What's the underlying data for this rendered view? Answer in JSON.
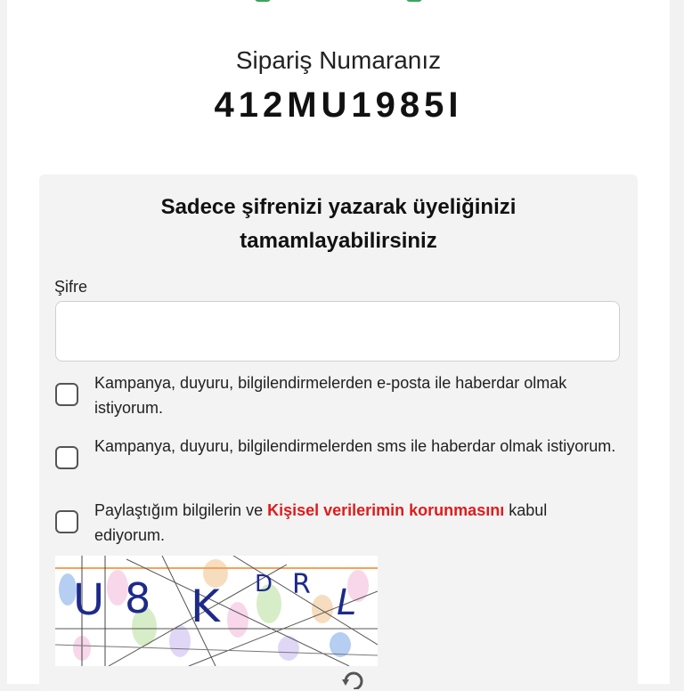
{
  "order": {
    "label": "Sipariş Numaranız",
    "number": "412MU1985I"
  },
  "registration": {
    "title": "Sadece şifrenizi yazarak üyeliğinizi tamamlayabilirsiniz",
    "password_label": "Şifre",
    "password_value": "",
    "checkboxes": [
      {
        "label": "Kampanya, duyuru, bilgilendirmelerden e-posta ile haberdar olmak istiyorum.",
        "checked": false
      },
      {
        "label": "Kampanya, duyuru, bilgilendirmelerden sms ile haberdar olmak istiyorum.",
        "checked": false
      },
      {
        "label_before": "Paylaştığım bilgilerin ve ",
        "link_text": "Kişisel verilerimin korunmasını",
        "label_after": " kabul ediyorum.",
        "checked": false
      }
    ],
    "captcha": {
      "characters": [
        "U",
        "8",
        "K",
        "D",
        "R",
        "L"
      ],
      "refresh_icon": "refresh-icon"
    }
  },
  "colors": {
    "accent_green": "#3aa65a",
    "link_red": "#e01b1b",
    "card_background": "#f3f3f3"
  }
}
